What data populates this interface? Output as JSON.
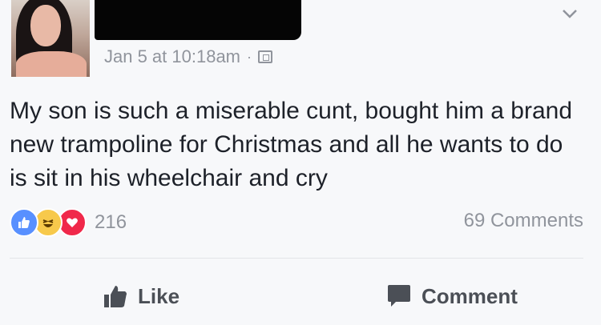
{
  "post": {
    "timestamp": "Jan 5 at 10:18am",
    "separator": "·",
    "privacy_icon": "globe-icon",
    "menu_icon": "chevron-down-icon",
    "text": "My son is such a miserable cunt, bought him a brand new trampoline for Christmas and all he wants to do is sit in his wheelchair and cry"
  },
  "reactions": {
    "types": [
      "like",
      "haha",
      "love"
    ],
    "count": "216"
  },
  "comments": {
    "count_label": "69 Comments"
  },
  "actions": {
    "like_label": "Like",
    "comment_label": "Comment"
  },
  "colors": {
    "like": "#5890ff",
    "haha": "#f7c94b",
    "love": "#f0284a",
    "meta": "#90949c"
  }
}
